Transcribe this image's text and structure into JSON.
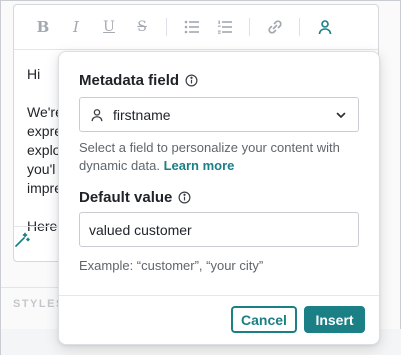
{
  "editor": {
    "toolbar": {
      "bold_glyph": "B",
      "italic_glyph": "I",
      "underline_glyph": "U",
      "strike_glyph": "S"
    },
    "body_lines": [
      "Hi",
      "",
      "We're",
      "expre",
      "explo",
      "you'l",
      "impre",
      "",
      "Here"
    ]
  },
  "background": {
    "section_label": "STYLES"
  },
  "popover": {
    "metadata_label": "Metadata field",
    "metadata_value": "firstname",
    "help_text": "Select a field to personalize your content with dynamic data.",
    "learn_more": "Learn more",
    "default_label": "Default value",
    "default_value": "valued customer",
    "example_text": "Example: “customer”, “your city”",
    "cancel_label": "Cancel",
    "insert_label": "Insert"
  },
  "colors": {
    "accent": "#1b7f86",
    "text": "#1f2328",
    "muted": "#5f666d",
    "border": "#c9cdd2"
  }
}
